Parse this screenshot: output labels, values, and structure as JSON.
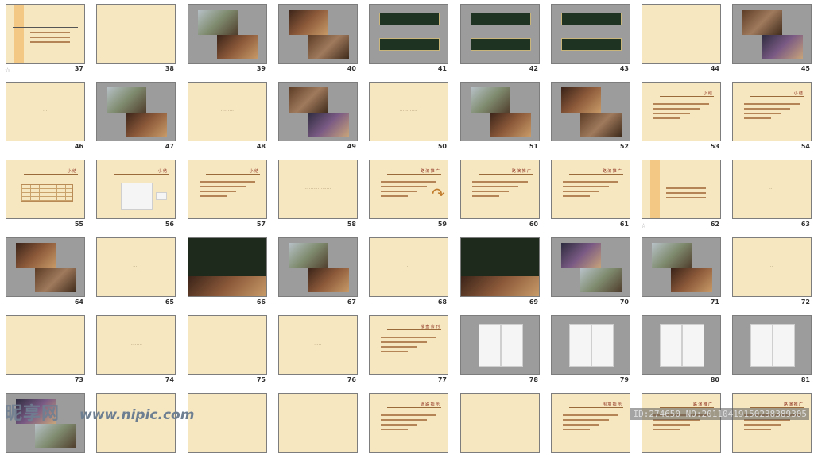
{
  "slides": [
    {
      "n": "37",
      "style": "timeline",
      "starred": true
    },
    {
      "n": "38",
      "style": "blank",
      "title": "···"
    },
    {
      "n": "39",
      "style": "photo-gray"
    },
    {
      "n": "40",
      "style": "photo-gray"
    },
    {
      "n": "41",
      "style": "banner-gray"
    },
    {
      "n": "42",
      "style": "banner-gray"
    },
    {
      "n": "43",
      "style": "banner-gray"
    },
    {
      "n": "44",
      "style": "blank",
      "title": "·····"
    },
    {
      "n": "45",
      "style": "photo-gray"
    },
    {
      "n": "46",
      "style": "blank",
      "title": "···"
    },
    {
      "n": "47",
      "style": "photo-gray"
    },
    {
      "n": "48",
      "style": "blank",
      "title": "·········"
    },
    {
      "n": "49",
      "style": "photo-gray"
    },
    {
      "n": "50",
      "style": "blank",
      "title": "············"
    },
    {
      "n": "51",
      "style": "photo-gray"
    },
    {
      "n": "52",
      "style": "photo-gray"
    },
    {
      "n": "53",
      "style": "text",
      "caption": "小 结"
    },
    {
      "n": "54",
      "style": "text",
      "caption": "小 结"
    },
    {
      "n": "55",
      "style": "table",
      "caption": "小 结"
    },
    {
      "n": "56",
      "style": "chart",
      "caption": "小 结"
    },
    {
      "n": "57",
      "style": "text",
      "caption": "小 结"
    },
    {
      "n": "58",
      "style": "blank",
      "title": "··················"
    },
    {
      "n": "59",
      "style": "arrow",
      "caption": "路 演 推 广"
    },
    {
      "n": "60",
      "style": "text",
      "caption": "路 演 推 广"
    },
    {
      "n": "61",
      "style": "text",
      "caption": "路 演 推 广"
    },
    {
      "n": "62",
      "style": "timeline",
      "starred": true
    },
    {
      "n": "63",
      "style": "blank",
      "title": "···"
    },
    {
      "n": "64",
      "style": "photo-gray"
    },
    {
      "n": "65",
      "style": "blank",
      "title": "····"
    },
    {
      "n": "66",
      "style": "dark-gray"
    },
    {
      "n": "67",
      "style": "photo-gray"
    },
    {
      "n": "68",
      "style": "blank",
      "title": "··"
    },
    {
      "n": "69",
      "style": "dark-gray"
    },
    {
      "n": "70",
      "style": "photo-gray"
    },
    {
      "n": "71",
      "style": "photo-gray"
    },
    {
      "n": "72",
      "style": "blank",
      "title": "··"
    },
    {
      "n": "73",
      "style": "blank",
      "title": ""
    },
    {
      "n": "74",
      "style": "blank",
      "title": "·········"
    },
    {
      "n": "75",
      "style": "blank",
      "title": ""
    },
    {
      "n": "76",
      "style": "blank",
      "title": "·····"
    },
    {
      "n": "77",
      "style": "text",
      "caption": "楼 盘 会 刊"
    },
    {
      "n": "78",
      "style": "book-gray"
    },
    {
      "n": "79",
      "style": "book-gray"
    },
    {
      "n": "80",
      "style": "book-gray"
    },
    {
      "n": "81",
      "style": "book-gray"
    },
    {
      "n": "",
      "style": "photo-gray"
    },
    {
      "n": "",
      "style": "blank",
      "title": ""
    },
    {
      "n": "",
      "style": "blank",
      "title": ""
    },
    {
      "n": "",
      "style": "blank",
      "title": "····"
    },
    {
      "n": "",
      "style": "text",
      "caption": "道 路 指 示"
    },
    {
      "n": "",
      "style": "blank",
      "title": "···"
    },
    {
      "n": "",
      "style": "text",
      "caption": "围 墙 指 示"
    },
    {
      "n": "",
      "style": "text",
      "caption": "路 演 推 广"
    },
    {
      "n": "",
      "style": "text",
      "caption": "路 演 推 广"
    }
  ],
  "watermark": {
    "logo": "昵享网",
    "url": "www.nipic.com",
    "id": "ID:274650 NO:20110419150238389305"
  }
}
